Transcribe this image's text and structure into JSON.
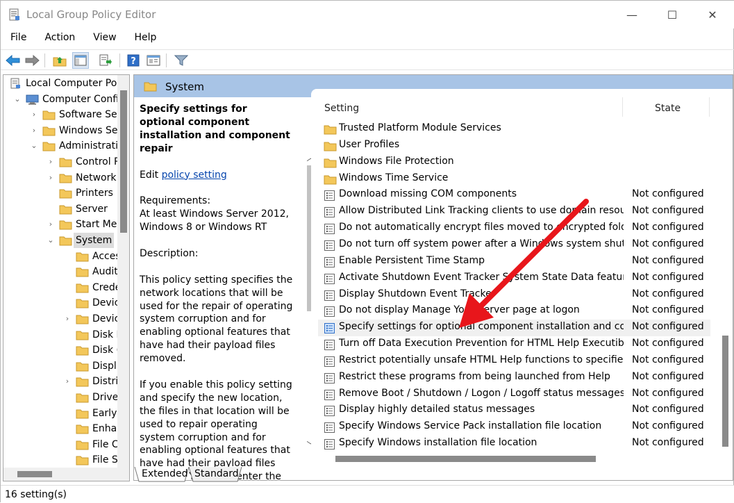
{
  "window": {
    "title": "Local Group Policy Editor",
    "minimize_glyph": "—",
    "maximize_glyph": "☐",
    "close_glyph": "✕"
  },
  "menu": [
    "File",
    "Action",
    "View",
    "Help"
  ],
  "toolbar_icons": [
    "back-arrow-icon",
    "forward-arrow-icon",
    "up-folder-icon",
    "show-hide-tree-icon",
    "export-list-icon",
    "help-icon",
    "properties-icon",
    "filter-icon"
  ],
  "tree": [
    {
      "label": "Local Computer Poli",
      "level": 0,
      "expander": "",
      "icon": "policy"
    },
    {
      "label": "Computer Confi",
      "level": 1,
      "expander": "⌄",
      "icon": "computer"
    },
    {
      "label": "Software Set",
      "level": 2,
      "expander": "›",
      "icon": "folder"
    },
    {
      "label": "Windows Set",
      "level": 2,
      "expander": "›",
      "icon": "folder"
    },
    {
      "label": "Administrativ",
      "level": 2,
      "expander": "⌄",
      "icon": "folder"
    },
    {
      "label": "Control P",
      "level": 3,
      "expander": "›",
      "icon": "folder"
    },
    {
      "label": "Network",
      "level": 3,
      "expander": "›",
      "icon": "folder"
    },
    {
      "label": "Printers",
      "level": 3,
      "expander": "",
      "icon": "folder"
    },
    {
      "label": "Server",
      "level": 3,
      "expander": "",
      "icon": "folder"
    },
    {
      "label": "Start Mer",
      "level": 3,
      "expander": "›",
      "icon": "folder"
    },
    {
      "label": "System",
      "level": 3,
      "expander": "⌄",
      "icon": "folder",
      "selected": true
    },
    {
      "label": "Acces",
      "level": 4,
      "expander": "",
      "icon": "folder"
    },
    {
      "label": "Audit",
      "level": 4,
      "expander": "",
      "icon": "folder"
    },
    {
      "label": "Crede",
      "level": 4,
      "expander": "",
      "icon": "folder"
    },
    {
      "label": "Devic",
      "level": 4,
      "expander": "",
      "icon": "folder"
    },
    {
      "label": "Devic",
      "level": 4,
      "expander": "›",
      "icon": "folder"
    },
    {
      "label": "Disk I",
      "level": 4,
      "expander": "",
      "icon": "folder"
    },
    {
      "label": "Disk (",
      "level": 4,
      "expander": "",
      "icon": "folder"
    },
    {
      "label": "Displ",
      "level": 4,
      "expander": "",
      "icon": "folder"
    },
    {
      "label": "Distri",
      "level": 4,
      "expander": "›",
      "icon": "folder"
    },
    {
      "label": "Drive",
      "level": 4,
      "expander": "",
      "icon": "folder"
    },
    {
      "label": "Early",
      "level": 4,
      "expander": "",
      "icon": "folder"
    },
    {
      "label": "Enha",
      "level": 4,
      "expander": "",
      "icon": "folder"
    },
    {
      "label": "File C",
      "level": 4,
      "expander": "",
      "icon": "folder"
    },
    {
      "label": "File S",
      "level": 4,
      "expander": "",
      "icon": "folder"
    }
  ],
  "main": {
    "header_title": "System",
    "desc": {
      "heading": "Specify settings for optional component installation and component repair",
      "edit_prefix": "Edit ",
      "edit_link": "policy setting ",
      "requirements_label": "Requirements:",
      "requirements_text": "At least Windows Server 2012, Windows 8 or Windows RT",
      "description_label": "Description:",
      "para1": "This policy setting specifies the network locations that will be used for the repair of operating system corruption and for enabling optional features that have had their payload files removed.",
      "para2": "If you enable this policy setting and specify the new location, the files in that location will be used to repair operating system corruption and for enabling optional features that have had their payload files removed. You must enter the fully qualified path"
    },
    "columns": {
      "setting": "Setting",
      "state": "State"
    },
    "rows": [
      {
        "name": "Trusted Platform Module Services",
        "state": "",
        "type": "folder"
      },
      {
        "name": "User Profiles",
        "state": "",
        "type": "folder"
      },
      {
        "name": "Windows File Protection",
        "state": "",
        "type": "folder"
      },
      {
        "name": "Windows Time Service",
        "state": "",
        "type": "folder"
      },
      {
        "name": "Download missing COM components",
        "state": "Not configured",
        "type": "setting"
      },
      {
        "name": "Allow Distributed Link Tracking clients to use domain resources",
        "state": "Not configured",
        "type": "setting"
      },
      {
        "name": "Do not automatically encrypt files moved to encrypted folders",
        "state": "Not configured",
        "type": "setting"
      },
      {
        "name": "Do not turn off system power after a Windows system shutd...",
        "state": "Not configured",
        "type": "setting"
      },
      {
        "name": "Enable Persistent Time Stamp",
        "state": "Not configured",
        "type": "setting"
      },
      {
        "name": "Activate Shutdown Event Tracker System State Data feature",
        "state": "Not configured",
        "type": "setting"
      },
      {
        "name": "Display Shutdown Event Tracker",
        "state": "Not configured",
        "type": "setting"
      },
      {
        "name": "Do not display Manage Your Server page at logon",
        "state": "Not configured",
        "type": "setting"
      },
      {
        "name": "Specify settings for optional component installation and com...",
        "state": "Not configured",
        "type": "setting",
        "selected": true
      },
      {
        "name": "Turn off Data Execution Prevention for HTML Help Executible",
        "state": "Not configured",
        "type": "setting"
      },
      {
        "name": "Restrict potentially unsafe HTML Help functions to specified f...",
        "state": "Not configured",
        "type": "setting"
      },
      {
        "name": "Restrict these programs from being launched from Help",
        "state": "Not configured",
        "type": "setting"
      },
      {
        "name": "Remove Boot / Shutdown / Logon / Logoff status messages",
        "state": "Not configured",
        "type": "setting"
      },
      {
        "name": "Display highly detailed status messages",
        "state": "Not configured",
        "type": "setting"
      },
      {
        "name": "Specify Windows Service Pack installation file location",
        "state": "Not configured",
        "type": "setting"
      },
      {
        "name": "Specify Windows installation file location",
        "state": "Not configured",
        "type": "setting"
      }
    ]
  },
  "tabs": [
    "Extended",
    "Standard"
  ],
  "status": "16 setting(s)",
  "colors": {
    "header_blue": "#a8c4e6",
    "link": "#0645ad",
    "arrow": "#e8161b",
    "folder": "#f3c75a"
  }
}
